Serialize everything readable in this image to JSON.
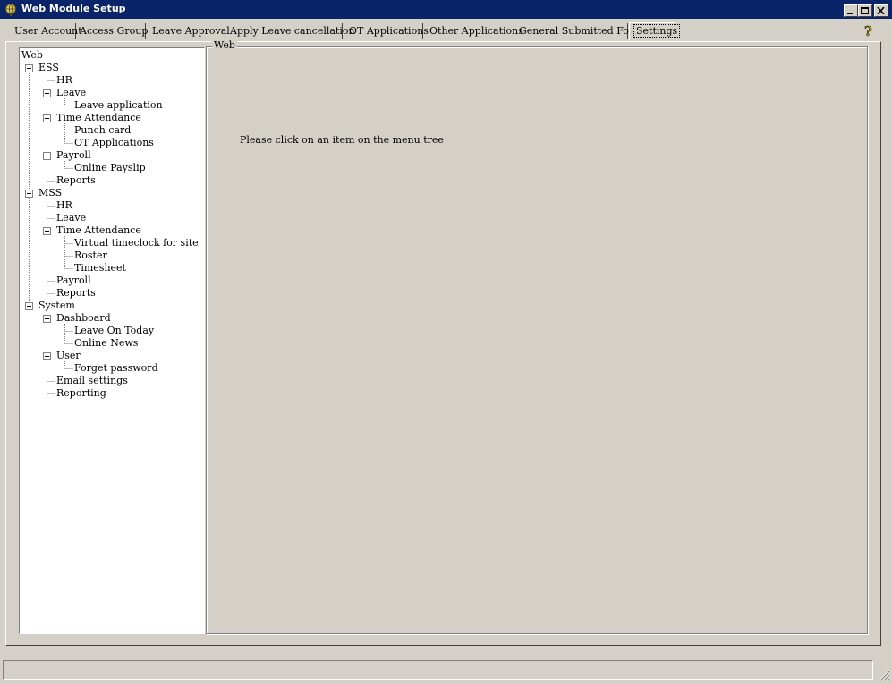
{
  "window": {
    "title": "Web Module Setup",
    "controls": [
      "minimize-icon",
      "maximize-icon",
      "close-icon"
    ]
  },
  "tabs": [
    {
      "label": "User Account"
    },
    {
      "label": "Access Group"
    },
    {
      "label": "Leave Approval"
    },
    {
      "label": "Apply Leave cancellation"
    },
    {
      "label": "OT Applications"
    },
    {
      "label": "Other Applications"
    },
    {
      "label": "General Submitted Form"
    },
    {
      "label": "Settings"
    }
  ],
  "active_tab": "Settings",
  "tree": {
    "root": "Web",
    "items": [
      {
        "label": "ESS"
      },
      {
        "label": "HR"
      },
      {
        "label": "Leave"
      },
      {
        "label": "Leave application"
      },
      {
        "label": "Time Attendance"
      },
      {
        "label": "Punch card"
      },
      {
        "label": "OT Applications"
      },
      {
        "label": "Payroll"
      },
      {
        "label": "Online Payslip"
      },
      {
        "label": "Reports"
      },
      {
        "label": "MSS"
      },
      {
        "label": "HR"
      },
      {
        "label": "Leave"
      },
      {
        "label": "Time Attendance"
      },
      {
        "label": "Virtual timeclock for site"
      },
      {
        "label": "Roster"
      },
      {
        "label": "Timesheet"
      },
      {
        "label": "Payroll"
      },
      {
        "label": "Reports"
      },
      {
        "label": "System"
      },
      {
        "label": "Dashboard"
      },
      {
        "label": "Leave On Today"
      },
      {
        "label": "Online News"
      },
      {
        "label": "User"
      },
      {
        "label": "Forget password"
      },
      {
        "label": "Email settings"
      },
      {
        "label": "Reporting"
      }
    ]
  },
  "panel": {
    "title": "Web",
    "message": "Please click on an item on the menu tree"
  },
  "colors": {
    "titlebar": "#0a246a",
    "face": "#d4d0c8",
    "tree_background": "#ffffff"
  }
}
